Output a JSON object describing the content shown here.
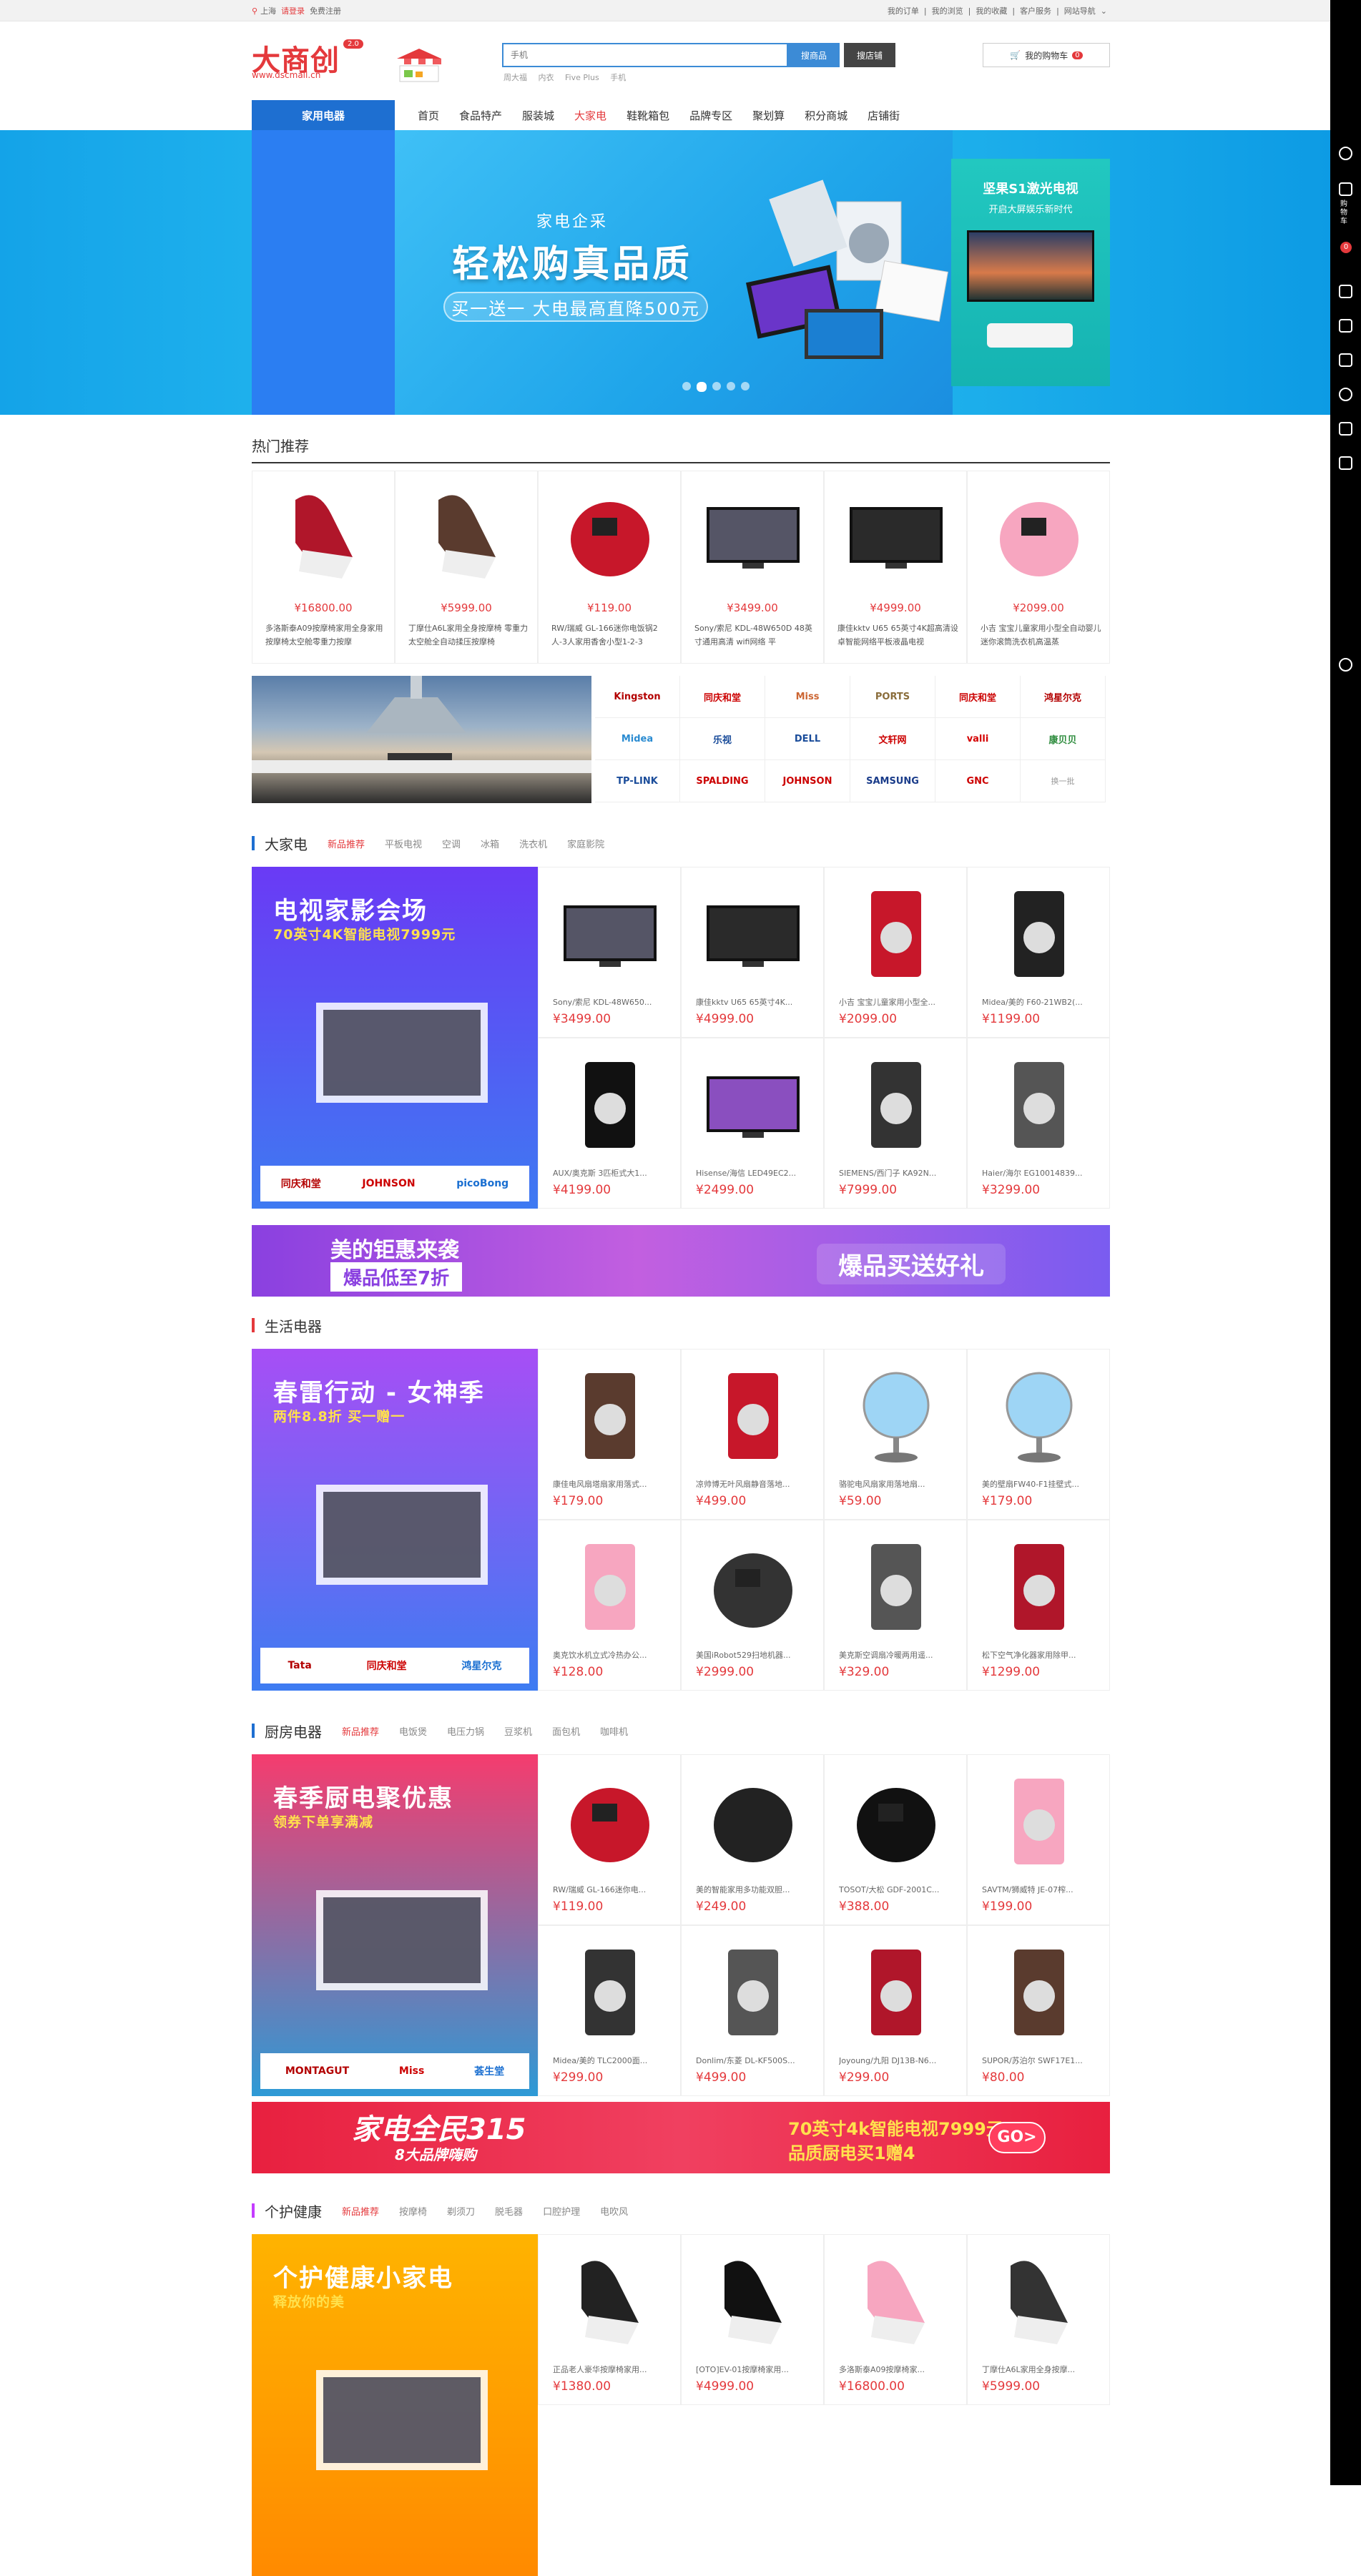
{
  "topbar": {
    "city": "上海",
    "login": "请登录",
    "register": "免费注册",
    "links": [
      "我的订单",
      "我的浏览",
      "我的收藏",
      "客户服务",
      "网站导航"
    ]
  },
  "header": {
    "logo": "大商创",
    "logo_badge": "2.0",
    "logo_url": "www.dscmall.cn",
    "search_placeholder": "手机",
    "search_btn": "搜商品",
    "shop_btn": "搜店铺",
    "hotwords": [
      "周大福",
      "内衣",
      "Five Plus",
      "手机"
    ],
    "cart_label": "我的购物车",
    "cart_count": "0"
  },
  "nav": {
    "category": "家用电器",
    "items": [
      "首页",
      "食品特产",
      "服装城",
      "大家电",
      "鞋靴箱包",
      "品牌专区",
      "聚划算",
      "积分商城",
      "店铺街"
    ],
    "active_index": 3
  },
  "banner": {
    "tag": "家电企采",
    "title": "轻松购真品质",
    "subtitle": "买一送一 大电最高直降500元",
    "right_title": "坚果S1激光电视",
    "right_sub": "开启大屏娱乐新时代"
  },
  "hot": {
    "title": "热门推荐",
    "items": [
      {
        "price": "¥16800.00",
        "name": "多洛斯泰A09按摩椅家用全身家用按摩椅太空舱零重力按摩"
      },
      {
        "price": "¥5999.00",
        "name": "丁摩仕A6L家用全身按摩椅 零重力太空舱全自动揉压按摩椅"
      },
      {
        "price": "¥119.00",
        "name": "RW/瑞威 GL-166迷你电饭锅2人-3人家用香舍小型1-2-3"
      },
      {
        "price": "¥3499.00",
        "name": "Sony/索尼 KDL-48W650D 48英寸通用高清 wifi网络 平"
      },
      {
        "price": "¥4999.00",
        "name": "康佳kktv U65 65英寸4K超高清设卓智能网络平板液晶电视"
      },
      {
        "price": "¥2099.00",
        "name": "小吉 宝宝儿童家用小型全自动婴儿迷你滚筒洗衣机高温蒸"
      }
    ]
  },
  "brands": [
    "Kingston",
    "同庆和堂",
    "Miss",
    "PORTS",
    "同庆和堂",
    "鸿星尔克",
    "Midea",
    "乐视",
    "DELL",
    "文轩网",
    "valli",
    "康贝贝",
    "TP-LINK",
    "SPALDING",
    "JOHNSON",
    "SAMSUNG",
    "GNC",
    "换一批"
  ],
  "floors": [
    {
      "name": "大家电",
      "bar_color": "#1e6fd1",
      "tabs": [
        "新品推荐",
        "平板电视",
        "空调",
        "冰箱",
        "洗衣机",
        "家庭影院"
      ],
      "left_title": "电视家影会场",
      "left_sub": "70英寸4K智能电视7999元",
      "left_bg": "#5b3ff0",
      "left_brands": [
        "同庆和堂",
        "JOHNSON",
        "picoBong"
      ],
      "products": [
        {
          "name": "Sony/索尼 KDL-48W650...",
          "price": "¥3499.00"
        },
        {
          "name": "康佳kktv U65 65英寸4K...",
          "price": "¥4999.00"
        },
        {
          "name": "小吉 宝宝儿童家用小型全...",
          "price": "¥2099.00"
        },
        {
          "name": "Midea/美的 F60-21WB2(...",
          "price": "¥1199.00"
        },
        {
          "name": "AUX/奥克斯 3匹柜式大1...",
          "price": "¥4199.00"
        },
        {
          "name": "Hisense/海信 LED49EC2...",
          "price": "¥2499.00"
        },
        {
          "name": "SIEMENS/西门子 KA92N...",
          "price": "¥7999.00"
        },
        {
          "name": "Haier/海尔 EG10014839...",
          "price": "¥3299.00"
        }
      ]
    },
    {
      "name": "生活电器",
      "bar_color": "#e4393c",
      "tabs": [],
      "left_title": "春雷行动 - 女神季",
      "left_sub": "两件8.8折 买一赠一",
      "left_bg": "#9b42f5",
      "left_brands": [
        "Tata",
        "同庆和堂",
        "鸿星尔克"
      ],
      "products": [
        {
          "name": "康佳电风扇塔扇家用落式...",
          "price": "¥179.00"
        },
        {
          "name": "凉帅博无叶风扇静音落地...",
          "price": "¥499.00"
        },
        {
          "name": "骆驼电风扇家用落地扇...",
          "price": "¥59.00"
        },
        {
          "name": "美的壁扇FW40-F1挂壁式...",
          "price": "¥179.00"
        },
        {
          "name": "奥克饮水机立式冷热办公...",
          "price": "¥128.00"
        },
        {
          "name": "美国iRobot529扫地机器...",
          "price": "¥2999.00"
        },
        {
          "name": "美克斯空调扇冷暖两用遥...",
          "price": "¥329.00"
        },
        {
          "name": "松下空气净化器家用除甲...",
          "price": "¥1299.00"
        }
      ]
    },
    {
      "name": "厨房电器",
      "bar_color": "#1e6fd1",
      "tabs": [
        "新品推荐",
        "电饭煲",
        "电压力锅",
        "豆浆机",
        "面包机",
        "咖啡机"
      ],
      "left_title": "春季厨电聚优惠",
      "left_sub": "领券下单享满减",
      "left_bg": "#f2457b",
      "left_brands": [
        "MONTAGUT",
        "Miss",
        "荟生堂"
      ],
      "products": [
        {
          "name": "RW/瑞威 GL-166迷你电...",
          "price": "¥119.00"
        },
        {
          "name": "美的智能家用多功能双胆...",
          "price": "¥249.00"
        },
        {
          "name": "TOSOT/大松 GDF-2001C...",
          "price": "¥388.00"
        },
        {
          "name": "SAVTM/狮威特 JE-07榨...",
          "price": "¥199.00"
        },
        {
          "name": "Midea/美的 TLC2000面...",
          "price": "¥299.00"
        },
        {
          "name": "Donlim/东菱 DL-KF500S...",
          "price": "¥499.00"
        },
        {
          "name": "Joyoung/九阳 DJ13B-N6...",
          "price": "¥299.00"
        },
        {
          "name": "SUPOR/苏泊尔 SWF17E1...",
          "price": "¥80.00"
        }
      ]
    },
    {
      "name": "个护健康",
      "bar_color": "#c43cff",
      "tabs": [
        "新品推荐",
        "按摩椅",
        "剃须刀",
        "脱毛器",
        "口腔护理",
        "电吹风"
      ],
      "left_title": "个护健康小家电",
      "left_sub": "释放你的美",
      "left_bg": "#ffb400",
      "left_brands": [],
      "products": [
        {
          "name": "正品老人豪华按摩椅家用...",
          "price": "¥1380.00"
        },
        {
          "name": "[OTO]EV-01按摩椅家用...",
          "price": "¥4999.00"
        },
        {
          "name": "多洛斯泰A09按摩椅家...",
          "price": "¥16800.00"
        },
        {
          "name": "丁摩仕A6L家用全身按摩...",
          "price": "¥5999.00"
        }
      ]
    }
  ],
  "promos": [
    {
      "left_title": "美的钜惠来袭",
      "left_sub": "爆品低至7折",
      "right": "爆品买送好礼"
    },
    {
      "left_title": "家电全民315",
      "left_sub": "8大品牌嗨购",
      "right": "70英寸4k智能电视7999元",
      "right_sub": "品质厨电买1赠4",
      "go": "GO>"
    }
  ],
  "sidebar": {
    "cart_label": "购物车",
    "cart_count": "0"
  }
}
